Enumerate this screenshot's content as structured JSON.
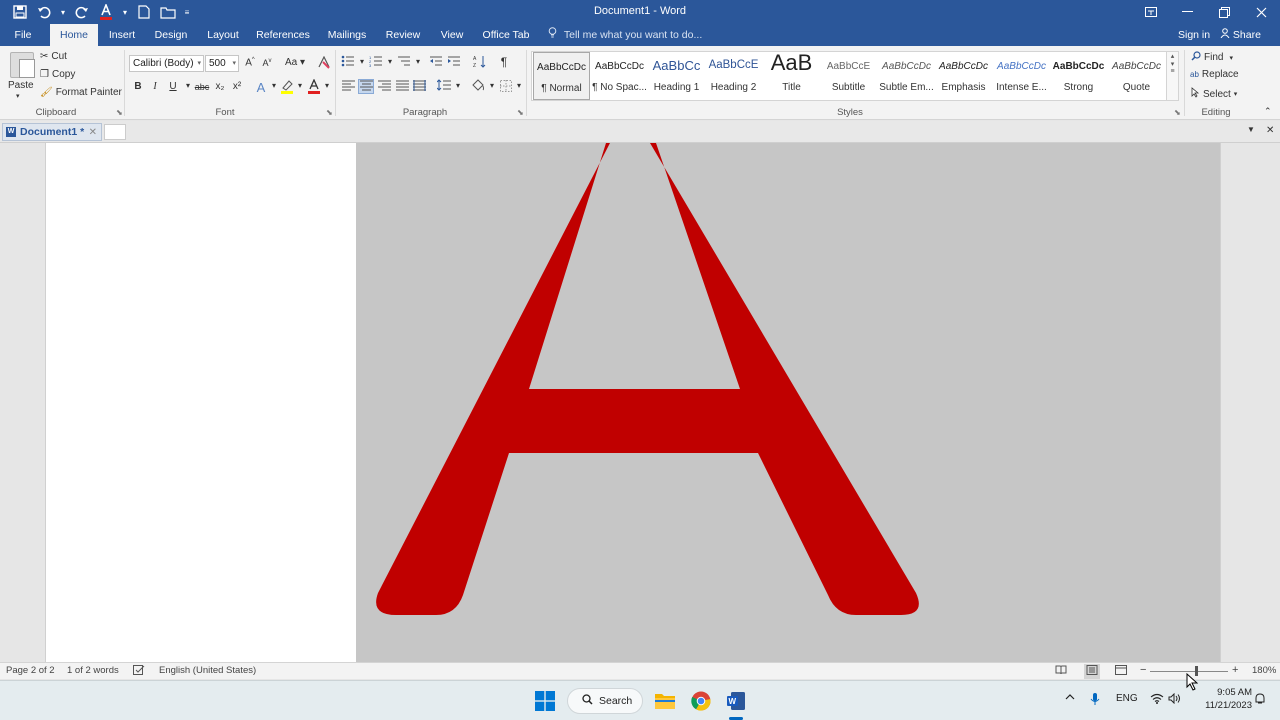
{
  "titlebar": {
    "title": "Document1  -  Word",
    "qat": [
      {
        "icon": "save-icon",
        "glyph": "💾"
      },
      {
        "icon": "undo-icon",
        "glyph": "↶"
      },
      {
        "icon": "redo-icon",
        "glyph": "↻"
      },
      {
        "icon": "font-color-icon",
        "glyph": "A"
      },
      {
        "icon": "new-document-icon",
        "glyph": "□"
      },
      {
        "icon": "open-folder-icon",
        "glyph": "▭"
      }
    ]
  },
  "tabs": [
    {
      "label": "File",
      "active": false
    },
    {
      "label": "Home",
      "active": true
    },
    {
      "label": "Insert",
      "active": false
    },
    {
      "label": "Design",
      "active": false
    },
    {
      "label": "Layout",
      "active": false
    },
    {
      "label": "References",
      "active": false
    },
    {
      "label": "Mailings",
      "active": false
    },
    {
      "label": "Review",
      "active": false
    },
    {
      "label": "View",
      "active": false
    },
    {
      "label": "Office Tab",
      "active": false
    }
  ],
  "tell_me": "Tell me what you want to do...",
  "account": {
    "sign_in": "Sign in",
    "share": "Share"
  },
  "clipboard": {
    "paste": "Paste",
    "cut": "Cut",
    "copy": "Copy",
    "format_painter": "Format Painter",
    "label": "Clipboard"
  },
  "font": {
    "name": "Calibri (Body)",
    "size": "500",
    "label": "Font",
    "case": "Aa",
    "bold": "B",
    "italic": "I",
    "underline": "U",
    "strike": "abc",
    "subscript": "x₂",
    "superscript": "x²"
  },
  "paragraph": {
    "label": "Paragraph"
  },
  "styles": {
    "label": "Styles",
    "items": [
      {
        "sample": "AaBbCcDc",
        "name": "¶ Normal",
        "selected": true
      },
      {
        "sample": "AaBbCcDc",
        "name": "¶ No Spac...",
        "selected": false
      },
      {
        "sample": "AaBbCc",
        "name": "Heading 1",
        "selected": false
      },
      {
        "sample": "AaBbCcE",
        "name": "Heading 2",
        "selected": false
      },
      {
        "sample": "AaB",
        "name": "Title",
        "selected": false
      },
      {
        "sample": "AaBbCcE",
        "name": "Subtitle",
        "selected": false
      },
      {
        "sample": "AaBbCcDc",
        "name": "Subtle Em...",
        "selected": false
      },
      {
        "sample": "AaBbCcDc",
        "name": "Emphasis",
        "selected": false
      },
      {
        "sample": "AaBbCcDc",
        "name": "Intense E...",
        "selected": false
      },
      {
        "sample": "AaBbCcDc",
        "name": "Strong",
        "selected": false
      },
      {
        "sample": "AaBbCcDc",
        "name": "Quote",
        "selected": false
      }
    ]
  },
  "editing": {
    "find": "Find",
    "replace": "Replace",
    "select": "Select",
    "label": "Editing"
  },
  "doc_tab": {
    "name": "Document1 *"
  },
  "document": {
    "big_letter": "A",
    "letter_color": "#c00000"
  },
  "status": {
    "page": "Page 2 of 2",
    "words": "1 of 2 words",
    "language": "English (United States)",
    "zoom": "180%",
    "zoom_minus": "−",
    "zoom_plus": "+"
  },
  "taskbar": {
    "search": "Search",
    "lang": "ENG",
    "time": "9:05 AM",
    "date": "11/21/2023"
  },
  "colors": {
    "word_blue": "#2b579a",
    "selection_gray": "#c6c6c6"
  }
}
